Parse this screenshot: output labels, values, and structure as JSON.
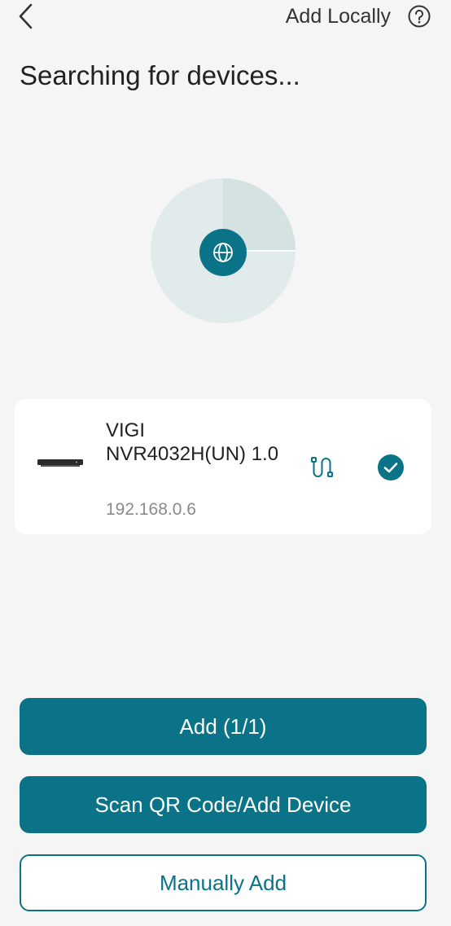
{
  "header": {
    "title": "Add Locally",
    "back_icon": "chevron-left-icon",
    "help_icon": "question-circle-icon"
  },
  "page": {
    "title": "Searching for devices..."
  },
  "scanner": {
    "center_icon": "globe-icon",
    "accent_color": "#0a7388"
  },
  "device": {
    "name": "VIGI NVR4032H(UN) 1.0",
    "ip": "192.168.0.6",
    "image_icon": "nvr-device-icon",
    "connection_icon": "wired-cable-icon",
    "selected": true
  },
  "buttons": {
    "add_label": "Add (1/1)",
    "scan_label": "Scan QR Code/Add Device",
    "manual_label": "Manually Add"
  },
  "colors": {
    "primary": "#0a7388",
    "background": "#f5f5f5",
    "card": "#ffffff"
  }
}
